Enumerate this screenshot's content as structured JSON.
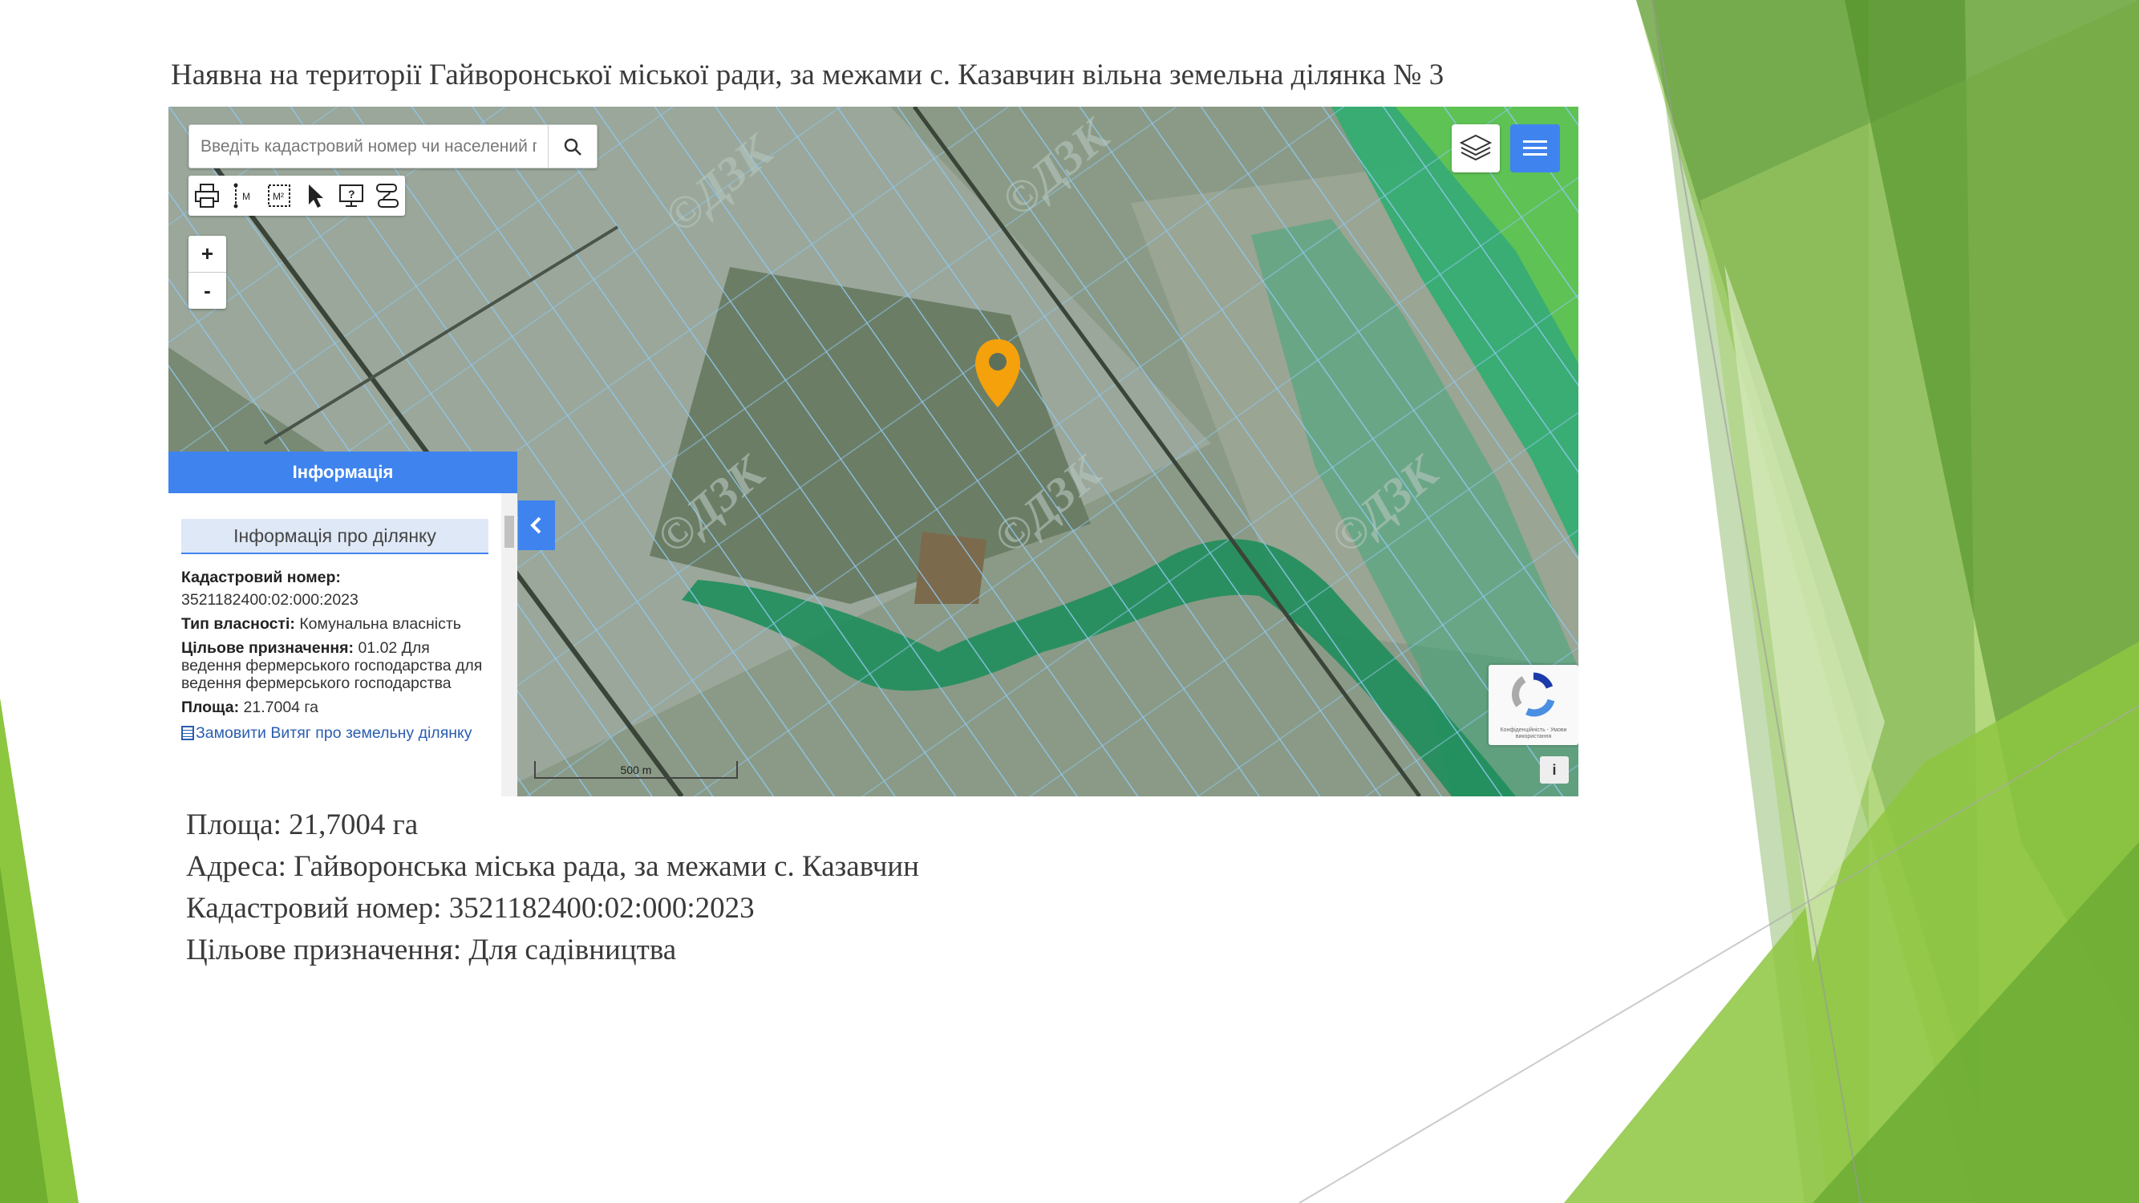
{
  "slide": {
    "title": "Наявна на території Гайворонської міської ради, за межами с. Казавчин вільна земельна ділянка № 3",
    "details": [
      "Площа: 21,7004 га",
      "Адреса: Гайворонська міська рада, за межами с. Казавчин",
      "Кадастровий номер: 3521182400:02:000:2023",
      "Цільове призначення: Для садівництва"
    ]
  },
  "map": {
    "search": {
      "placeholder": "Введіть кадастровий номер чи населений пункт"
    },
    "toolbar_icons": [
      "print-icon",
      "measure-length-icon",
      "measure-area-icon",
      "select-cursor-icon",
      "identify-icon",
      "route-icon"
    ],
    "toolbar_labels": {
      "length": "M",
      "area": "M²"
    },
    "zoom": {
      "in": "+",
      "out": "-"
    },
    "scale_label": "500 m",
    "watermark": "©ДЗК",
    "info_button": "i",
    "recaptcha_text": "Конфіденційність - Умови використання",
    "colors": {
      "accent": "#3f84ee",
      "marker": "#f4a10c",
      "parcel_lines": "#8fc8ef",
      "forest": "#1f9a6a"
    }
  },
  "info_panel": {
    "header": "Інформація",
    "subtitle": "Інформація про ділянку",
    "cadastral_label": "Кадастровий номер:",
    "cadastral_value": "3521182400:02:000:2023",
    "ownership_label": "Тип власності:",
    "ownership_value": "Комунальна власність",
    "purpose_label": "Цільове призначення:",
    "purpose_value": "01.02 Для ведення фермерського господарства для ведення фермерського господарства",
    "area_label": "Площа:",
    "area_value": "21.7004 га",
    "order_link": "Замовити Витяг про земельну ділянку"
  }
}
